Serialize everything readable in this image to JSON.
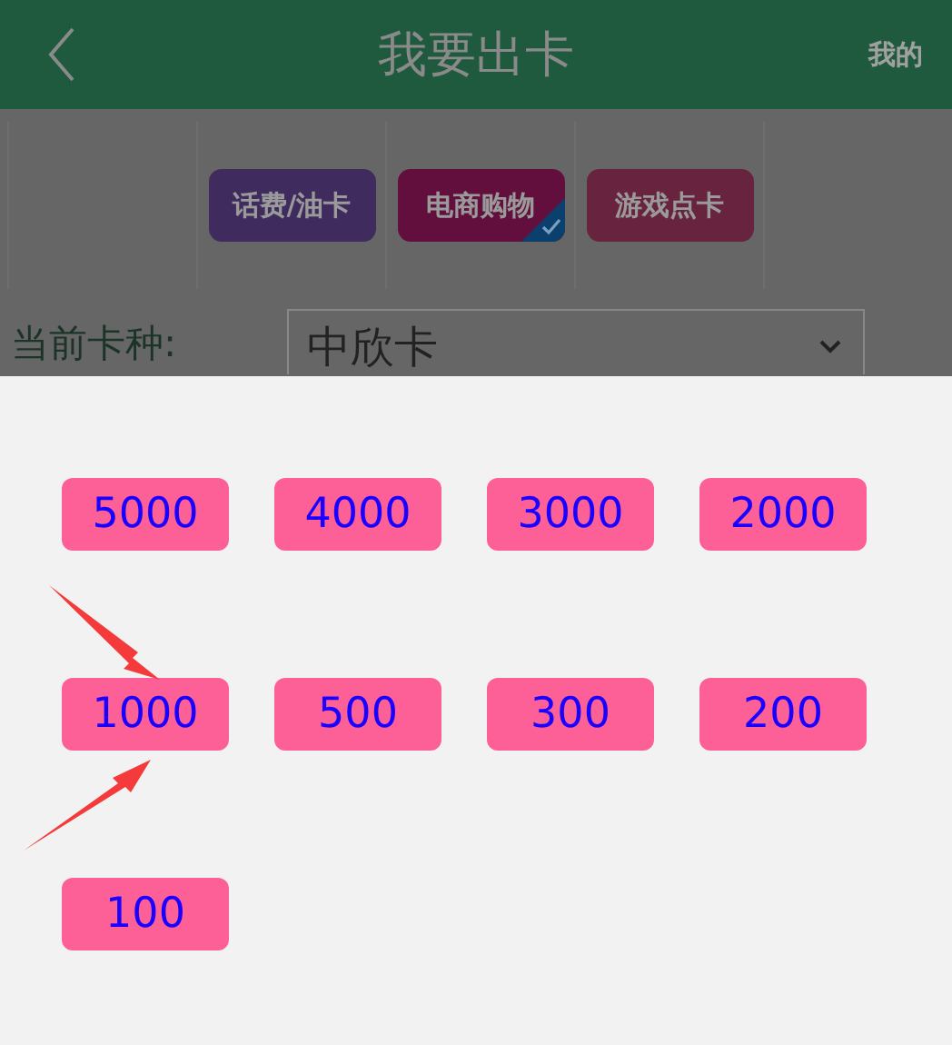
{
  "header": {
    "title": "我要出卡",
    "right_link": "我的"
  },
  "categories": [
    {
      "label": "话费/油卡",
      "color": "#3f2b5d",
      "selected": false
    },
    {
      "label": "电商购物",
      "color": "#630f3e",
      "selected": true
    },
    {
      "label": "游戏点卡",
      "color": "#68233e",
      "selected": false
    }
  ],
  "card_type": {
    "label": "当前卡种:",
    "value": "中欣卡"
  },
  "amounts": [
    "5000",
    "4000",
    "3000",
    "2000",
    "1000",
    "500",
    "300",
    "200",
    "100"
  ]
}
